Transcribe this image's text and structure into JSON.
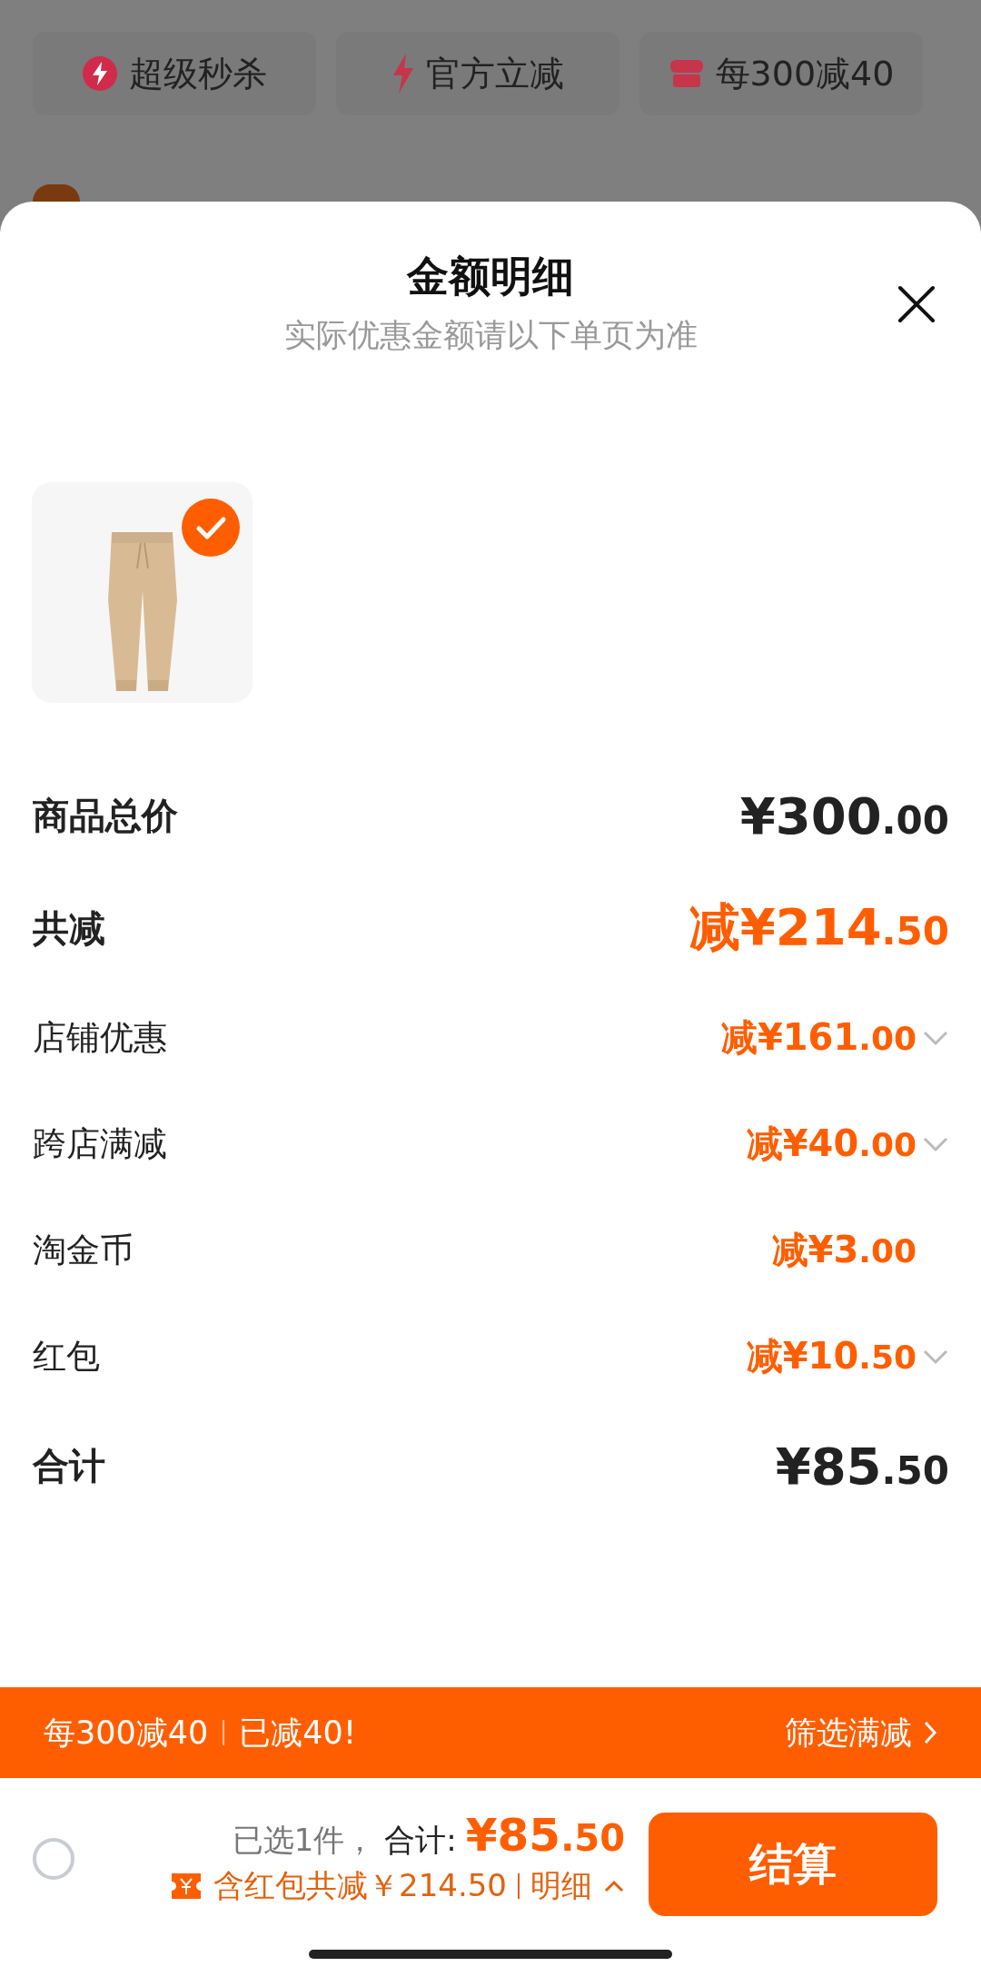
{
  "background": {
    "chips": [
      {
        "kind": "flash",
        "label": "超级秒杀"
      },
      {
        "kind": "bolt",
        "label": "官方立减"
      },
      {
        "kind": "shop",
        "label": "每300减40"
      }
    ]
  },
  "sheet": {
    "title": "金额明细",
    "subtitle": "实际优惠金额请以下单页为准",
    "product": {
      "kind": "picture",
      "checked": true
    },
    "rows": [
      {
        "kind": "total",
        "label": "商品总价",
        "main": "¥300",
        "cents": ".00",
        "expandable": false
      },
      {
        "kind": "discount",
        "label": "共减",
        "main": "减¥214",
        "cents": ".50",
        "expandable": false
      },
      {
        "kind": "item",
        "label": "店铺优惠",
        "main": "减¥161",
        "cents": ".00",
        "expandable": true
      },
      {
        "kind": "item",
        "label": "跨店满减",
        "main": "减¥40",
        "cents": ".00",
        "expandable": true
      },
      {
        "kind": "item",
        "label": "淘金币",
        "main": "减¥3",
        "cents": ".00",
        "expandable": false
      },
      {
        "kind": "item",
        "label": "红包",
        "main": "减¥10",
        "cents": ".50",
        "expandable": true
      },
      {
        "kind": "total",
        "label": "合计",
        "main": "¥85",
        "cents": ".50",
        "expandable": false
      }
    ]
  },
  "promo_bar": {
    "rule": "每300减40",
    "status": "已减40!",
    "link": "筛选满减"
  },
  "checkout": {
    "select_all": {
      "checked": false
    },
    "selected": "已选1件，",
    "total_label": "合计:",
    "total_main": "¥85",
    "total_cents": ".50",
    "saving": "含红包共减￥214.50",
    "detail": "明细",
    "expanded": true,
    "button": "结算"
  }
}
